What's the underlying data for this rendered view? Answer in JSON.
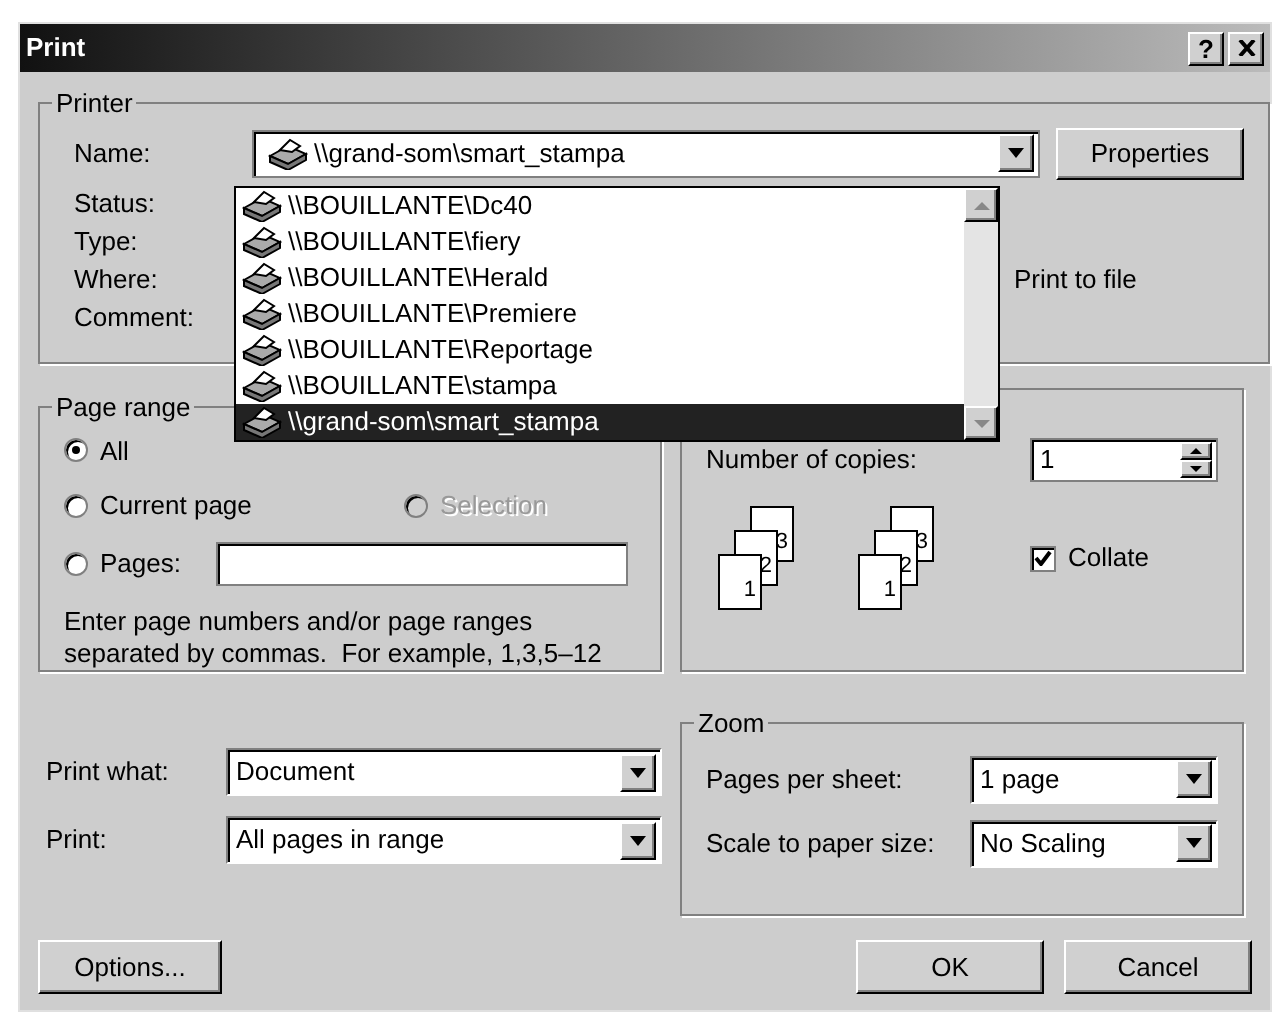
{
  "window": {
    "title": "Print",
    "help": "?"
  },
  "printer": {
    "legend": "Printer",
    "name_label": "Name:",
    "name_value": "\\\\grand-som\\smart_stampa",
    "properties": "Properties",
    "labels": [
      "Status:",
      "Type:",
      "Where:",
      "Comment:"
    ],
    "print_to_file": "Print to file"
  },
  "printer_list": [
    {
      "name": "\\\\BOUILLANTE\\Dc40",
      "selected": false
    },
    {
      "name": "\\\\BOUILLANTE\\fiery",
      "selected": false
    },
    {
      "name": "\\\\BOUILLANTE\\Herald",
      "selected": false
    },
    {
      "name": "\\\\BOUILLANTE\\Premiere",
      "selected": false
    },
    {
      "name": "\\\\BOUILLANTE\\Reportage",
      "selected": false
    },
    {
      "name": "\\\\BOUILLANTE\\stampa",
      "selected": false
    },
    {
      "name": "\\\\grand-som\\smart_stampa",
      "selected": true
    }
  ],
  "page_range": {
    "legend": "Page range",
    "options": [
      {
        "kind": "radio",
        "label": "All",
        "selected": true,
        "disabled": false
      },
      {
        "kind": "radio",
        "label": "Current page",
        "selected": false,
        "disabled": false
      },
      {
        "kind": "radio",
        "label": "Selection",
        "selected": false,
        "disabled": true
      },
      {
        "kind": "radio-field",
        "label": "Pages:",
        "selected": false,
        "disabled": false
      }
    ],
    "hint": "Enter page numbers and/or page ranges separated by commas.  For example, 1,3,5–12"
  },
  "copies": {
    "label": "Number of copies:",
    "value": "1",
    "page_stacks": [
      [
        "1",
        "2",
        "3"
      ],
      [
        "1",
        "2",
        "3"
      ]
    ],
    "collate": {
      "label": "Collate",
      "checked": true
    }
  },
  "print_what": {
    "label": "Print what:",
    "value": "Document"
  },
  "print": {
    "label": "Print:",
    "value": "All pages in range"
  },
  "zoom": {
    "legend": "Zoom",
    "pages_per_sheet": {
      "label": "Pages per sheet:",
      "value": "1 page"
    },
    "scale": {
      "label": "Scale to paper size:",
      "value": "No Scaling"
    }
  },
  "buttons": {
    "options": "Options...",
    "ok": "OK",
    "cancel": "Cancel"
  }
}
